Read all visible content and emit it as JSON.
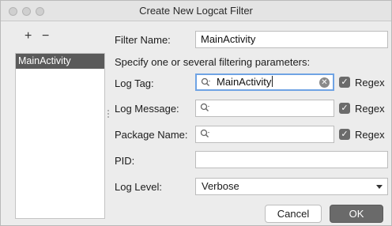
{
  "window": {
    "title": "Create New Logcat Filter"
  },
  "sidebar": {
    "add_label": "+",
    "remove_label": "−",
    "items": [
      {
        "label": "MainActivity",
        "selected": true
      }
    ]
  },
  "form": {
    "filter_name": {
      "label": "Filter Name:",
      "value": "MainActivity"
    },
    "hint": "Specify one or several filtering parameters:",
    "log_tag": {
      "label": "Log Tag:",
      "value": "MainActivity",
      "regex_label": "Regex",
      "regex_checked": true
    },
    "log_message": {
      "label": "Log Message:",
      "value": "",
      "regex_label": "Regex",
      "regex_checked": true
    },
    "package_name": {
      "label": "Package Name:",
      "value": "",
      "regex_label": "Regex",
      "regex_checked": true
    },
    "pid": {
      "label": "PID:",
      "value": ""
    },
    "log_level": {
      "label": "Log Level:",
      "selected": "Verbose"
    }
  },
  "buttons": {
    "cancel": "Cancel",
    "ok": "OK"
  },
  "icons": {
    "search": "search-icon",
    "clear": "clear-icon",
    "check": "check-icon",
    "dropdown": "chevron-down-icon"
  }
}
